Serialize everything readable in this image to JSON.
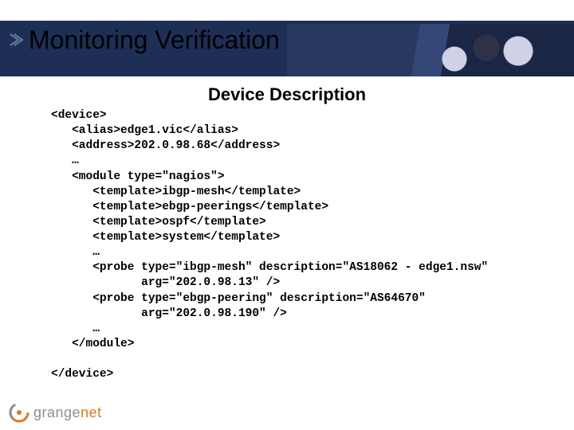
{
  "title": "Monitoring Verification",
  "subtitle": "Device Description",
  "code": "<device>\n   <alias>edge1.vic</alias>\n   <address>202.0.98.68</address>\n   …\n   <module type=\"nagios\">\n      <template>ibgp-mesh</template>\n      <template>ebgp-peerings</template>\n      <template>ospf</template>\n      <template>system</template>\n      …\n      <probe type=\"ibgp-mesh\" description=\"AS18062 - edge1.nsw\"\n             arg=\"202.0.98.13\" />\n      <probe type=\"ebgp-peering\" description=\"AS64670\"\n             arg=\"202.0.98.190\" />\n      …\n   </module>\n\n</device>",
  "logo": {
    "brand_gray": "grange",
    "brand_orange": "net"
  }
}
